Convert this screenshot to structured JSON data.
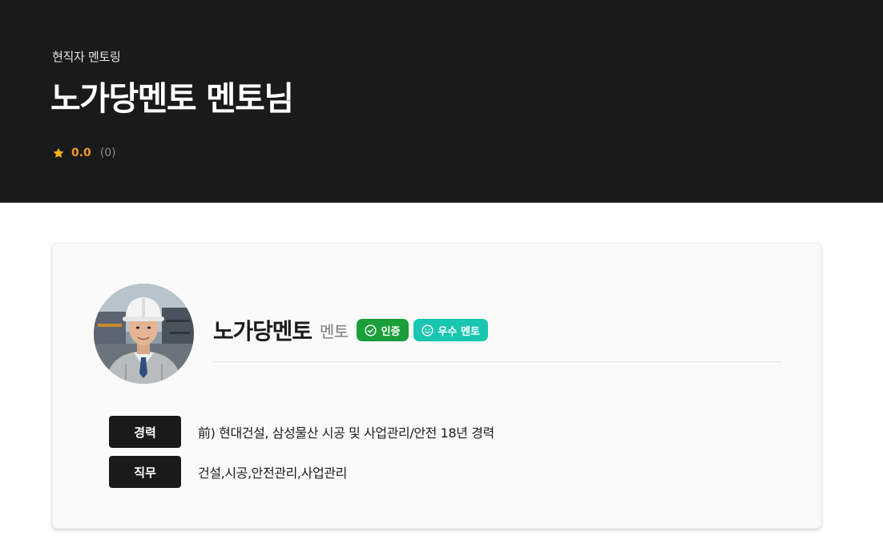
{
  "hero": {
    "eyebrow": "현직자 멘토링",
    "title": "노가당멘토 멘토님",
    "rating": {
      "score": "0.0",
      "count": "(0)",
      "icon": "star-icon"
    }
  },
  "profile": {
    "avatar_alt": "멘토 프로필 사진",
    "name": "노가당멘토",
    "role": "멘토",
    "badges": [
      {
        "label": "인증",
        "icon": "check-circle-icon",
        "color": "#1a9f3a"
      },
      {
        "label": "우수 멘토",
        "icon": "smile-icon",
        "color": "#19c6b0"
      }
    ],
    "info": [
      {
        "label": "경력",
        "value": "前) 현대건설, 삼성물산 시공 및 사업관리/안전 18년 경력"
      },
      {
        "label": "직무",
        "value": "건설,시공,안전관리,사업관리"
      }
    ]
  },
  "colors": {
    "hero_bg": "#1a1a1a",
    "rating_score": "#f29a1f",
    "star": "#f5b31c"
  }
}
